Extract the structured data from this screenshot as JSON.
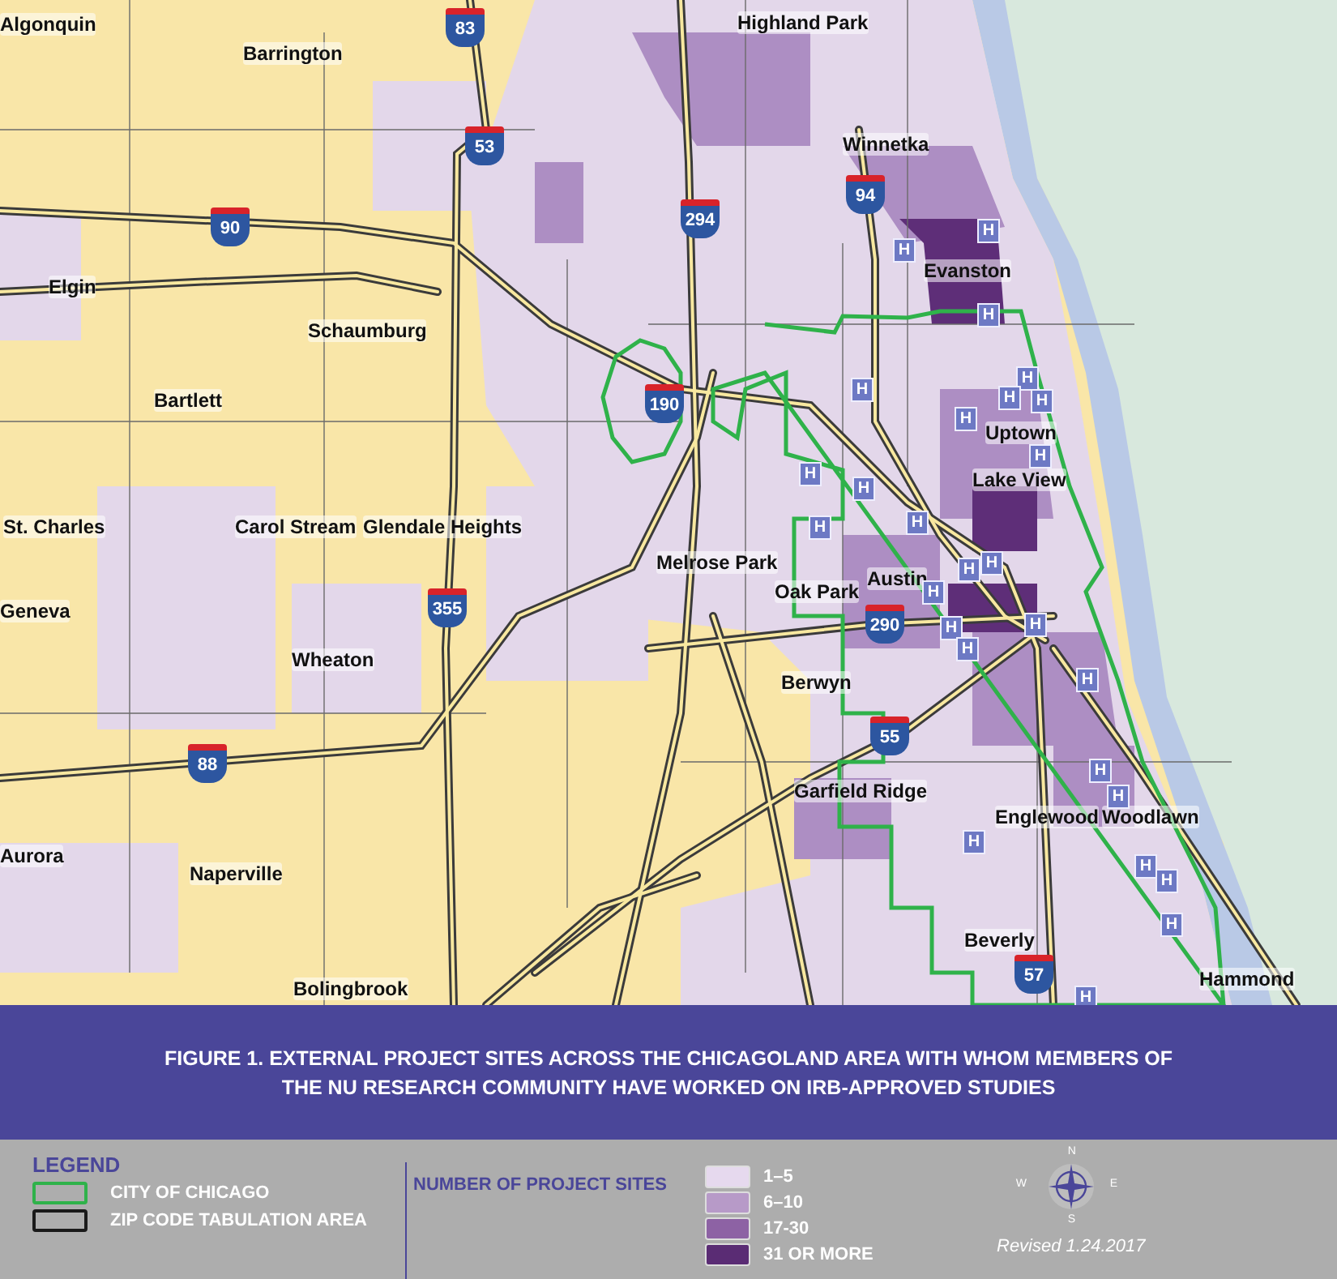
{
  "map": {
    "places": [
      "Algonquin",
      "Barrington",
      "Highland Park",
      "Winnetka",
      "Evanston",
      "Elgin",
      "Schaumburg",
      "Bartlett",
      "Uptown",
      "Lake View",
      "St. Charles",
      "Carol Stream",
      "Glendale Heights",
      "Melrose Park",
      "Geneva",
      "Austin",
      "Oak Park",
      "Wheaton",
      "Berwyn",
      "Garfield Ridge",
      "Englewood",
      "Woodlawn",
      "Aurora",
      "Naperville",
      "Beverly",
      "Hammond",
      "Bolingbrook"
    ],
    "interstates": [
      "83",
      "53",
      "90",
      "94",
      "294",
      "190",
      "355",
      "290",
      "88",
      "55",
      "57"
    ],
    "hospital_markers": [
      "H",
      "H",
      "H",
      "H",
      "H",
      "H",
      "H",
      "H",
      "H",
      "H",
      "H",
      "H",
      "H",
      "H",
      "H",
      "H",
      "H",
      "H",
      "H",
      "H",
      "H",
      "H",
      "H",
      "H",
      "H",
      "H",
      "H"
    ]
  },
  "caption": [
    "FIGURE 1. EXTERNAL PROJECT SITES ACROSS THE CHICAGOLAND AREA WITH WHOM MEMBERS OF",
    "THE NU RESEARCH COMMUNITY HAVE WORKED ON IRB-APPROVED STUDIES"
  ],
  "legend": {
    "title": "LEGEND",
    "boundaries": [
      {
        "label": "CITY OF CHICAGO",
        "color": "#2fb24a"
      },
      {
        "label": "ZIP CODE TABULATION AREA",
        "color": "#1a1a1a"
      }
    ],
    "scale_title": "NUMBER OF PROJECT SITES",
    "classes": [
      {
        "label": "1–5",
        "color": "#e6d9ee"
      },
      {
        "label": "6–10",
        "color": "#b79ac8"
      },
      {
        "label": "17-30",
        "color": "#8d62a4"
      },
      {
        "label": "31 OR MORE",
        "color": "#5a2c74"
      }
    ]
  },
  "compass": {
    "letters": [
      "N",
      "E",
      "S",
      "W"
    ]
  },
  "revised": "Revised 1.24.2017"
}
